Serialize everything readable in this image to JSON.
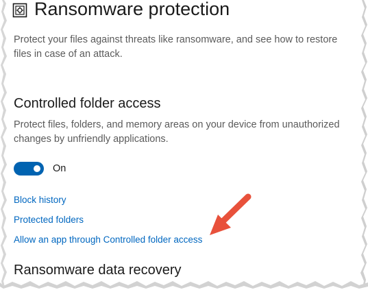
{
  "header": {
    "title": "Ransomware protection",
    "icon": "shield-icon",
    "intro": "Protect your files against threats like ransomware, and see how to restore files in case of an attack."
  },
  "controlled_folder_access": {
    "title": "Controlled folder access",
    "description": "Protect files, folders, and memory areas on your device from unauthorized changes by unfriendly applications.",
    "toggle_state": "on",
    "toggle_label": "On",
    "links": {
      "block_history": "Block history",
      "protected_folders": "Protected folders",
      "allow_app": "Allow an app through Controlled folder access"
    }
  },
  "recovery": {
    "title": "Ransomware data recovery"
  },
  "colors": {
    "accent": "#0063b1",
    "link": "#0067c0",
    "arrow": "#e8513b"
  }
}
